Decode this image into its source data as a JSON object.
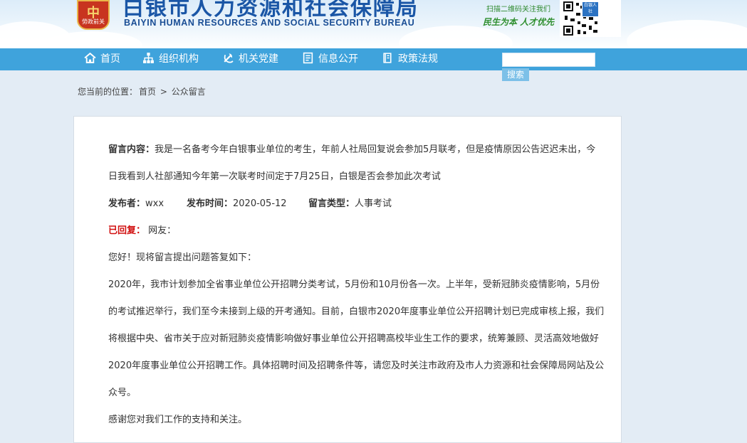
{
  "header": {
    "emblem_glyph": "中",
    "emblem_text": "勞政前关",
    "title": "白银市人力资源和社会保障局",
    "subtitle": "BAIYIN HUMAN RESOURCES AND SOCIAL SECURITY BUREAU",
    "qr_caption": "扫描二维码关注我们",
    "slogan": "民生为本  人才优先",
    "qr_badge": "白银人社"
  },
  "nav": {
    "items": [
      {
        "label": "首页",
        "icon": "home-icon"
      },
      {
        "label": "组织机构",
        "icon": "org-chart-icon"
      },
      {
        "label": "机关党建",
        "icon": "party-emblem-icon"
      },
      {
        "label": "信息公开",
        "icon": "document-icon"
      },
      {
        "label": "政策法规",
        "icon": "book-icon"
      }
    ],
    "search": {
      "value": "",
      "placeholder": "",
      "button_label": "搜索"
    }
  },
  "breadcrumb": {
    "prefix": "您当前的位置：",
    "items": [
      "首页",
      "公众留言"
    ],
    "separator": ">"
  },
  "message": {
    "content_label": "留言内容：",
    "content_line1": "我是一名备考今年白银事业单位的考生，年前人社局回复说会参加5月联考，但是疫情原因公告迟迟未出，今",
    "content_line2": "日我看到人社部通知今年第一次联考时间定于7月25日，白银是否会参加此次考试",
    "author_label": "发布者：",
    "author": "wxx",
    "time_label": "发布时间：",
    "time": "2020-05-12",
    "type_label": "留言类型：",
    "type": "人事考试"
  },
  "reply": {
    "status_label": "已回复：",
    "to": "网友：",
    "greeting": "您好！现将留言提出问题答复如下：",
    "lines": [
      "2020年，我市计划参加全省事业单位公开招聘分类考试，5月份和10月份各一次。上半年，受新冠肺炎疫情影响，5月份",
      "的考试推迟举行，我们至今未接到上级的开考通知。目前，白银市2020年度事业单位公开招聘计划已完成审核上报，我们",
      "将根据中央、省市关于应对新冠肺炎疫情影响做好事业单位公开招聘高校毕业生工作的要求，统筹兼顾、灵活高效地做好",
      "2020年度事业单位公开招聘工作。具体招聘时间及招聘条件等，请您及时关注市政府及市人力资源和社会保障局网站及公",
      "众号。"
    ],
    "closing": "感谢您对我们工作的支持和关注。"
  },
  "colors": {
    "nav_bg": "#3fa3dc",
    "title_blue": "#1a56a6",
    "reply_red": "#d11010",
    "page_bg": "#e3ecf5"
  }
}
